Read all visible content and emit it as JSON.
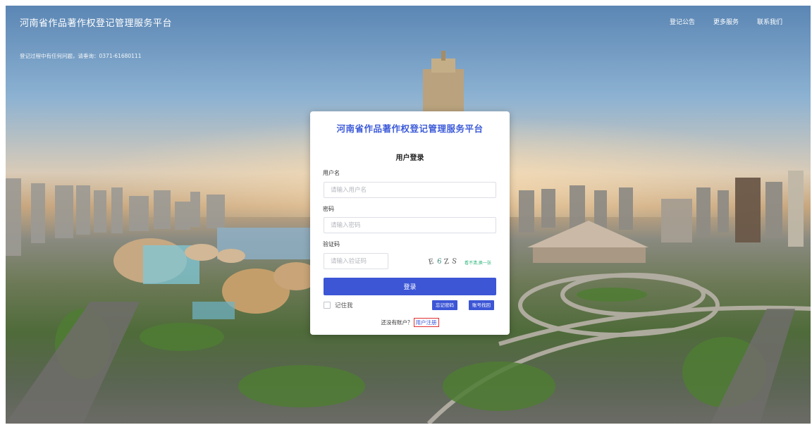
{
  "header": {
    "title": "河南省作品著作权登记管理服务平台",
    "notice": "登记过程中有任何问题，请垂询：0371-61680111",
    "nav": [
      "登记公告",
      "更多服务",
      "联系我们"
    ]
  },
  "login": {
    "title": "河南省作品著作权登记管理服务平台",
    "subtitle": "用户登录",
    "username_label": "用户名",
    "username_placeholder": "请输入用户名",
    "password_label": "密码",
    "password_placeholder": "请输入密码",
    "captcha_label": "验证码",
    "captcha_placeholder": "请输入验证码",
    "captcha_chars": [
      "E",
      "6",
      "Z",
      "S"
    ],
    "captcha_refresh": "看不清,换一张",
    "submit": "登录",
    "remember": "记住我",
    "forgot_password": "忘记密码",
    "recover_account": "账号找回",
    "no_account": "还没有账户？",
    "register": "用户注册"
  },
  "colors": {
    "accent": "#3c56d6",
    "title": "#3d5bd9",
    "highlight_border": "#e0302e"
  }
}
